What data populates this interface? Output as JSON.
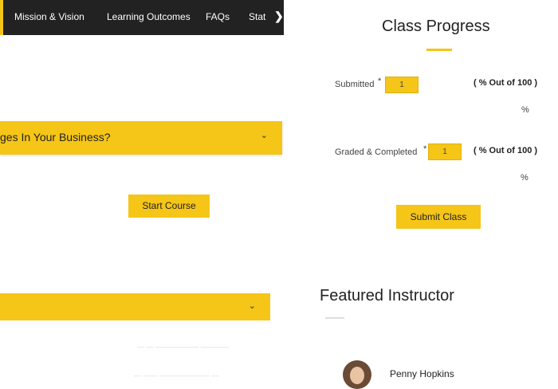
{
  "tabs": {
    "items": [
      "Mission & Vision",
      "Learning Outcomes",
      "FAQs",
      "Stat"
    ],
    "more": "❯"
  },
  "accordions": [
    {
      "title": "ges In Your Business?",
      "chevron": "⌄"
    },
    {
      "title": "",
      "chevron": "⌄"
    }
  ],
  "buttons": {
    "start_course": "Start Course",
    "submit_class": "Submit Class"
  },
  "faint_rows": [
    "—   —   ——————   ————",
    "—   ——   ———————   —"
  ],
  "class_progress": {
    "title": "Class Progress",
    "submitted": {
      "label": "Submitted",
      "value": "1",
      "out_of": "( % Out of 100 )",
      "unit": "%"
    },
    "graded": {
      "label": "Graded & Completed",
      "value": "1",
      "out_of": "( % Out of 100 )",
      "unit": "%"
    }
  },
  "featured_instructor": {
    "title": "Featured Instructor",
    "name": "Penny Hopkins"
  },
  "colors": {
    "accent": "#f5c518",
    "dark": "#222222"
  }
}
